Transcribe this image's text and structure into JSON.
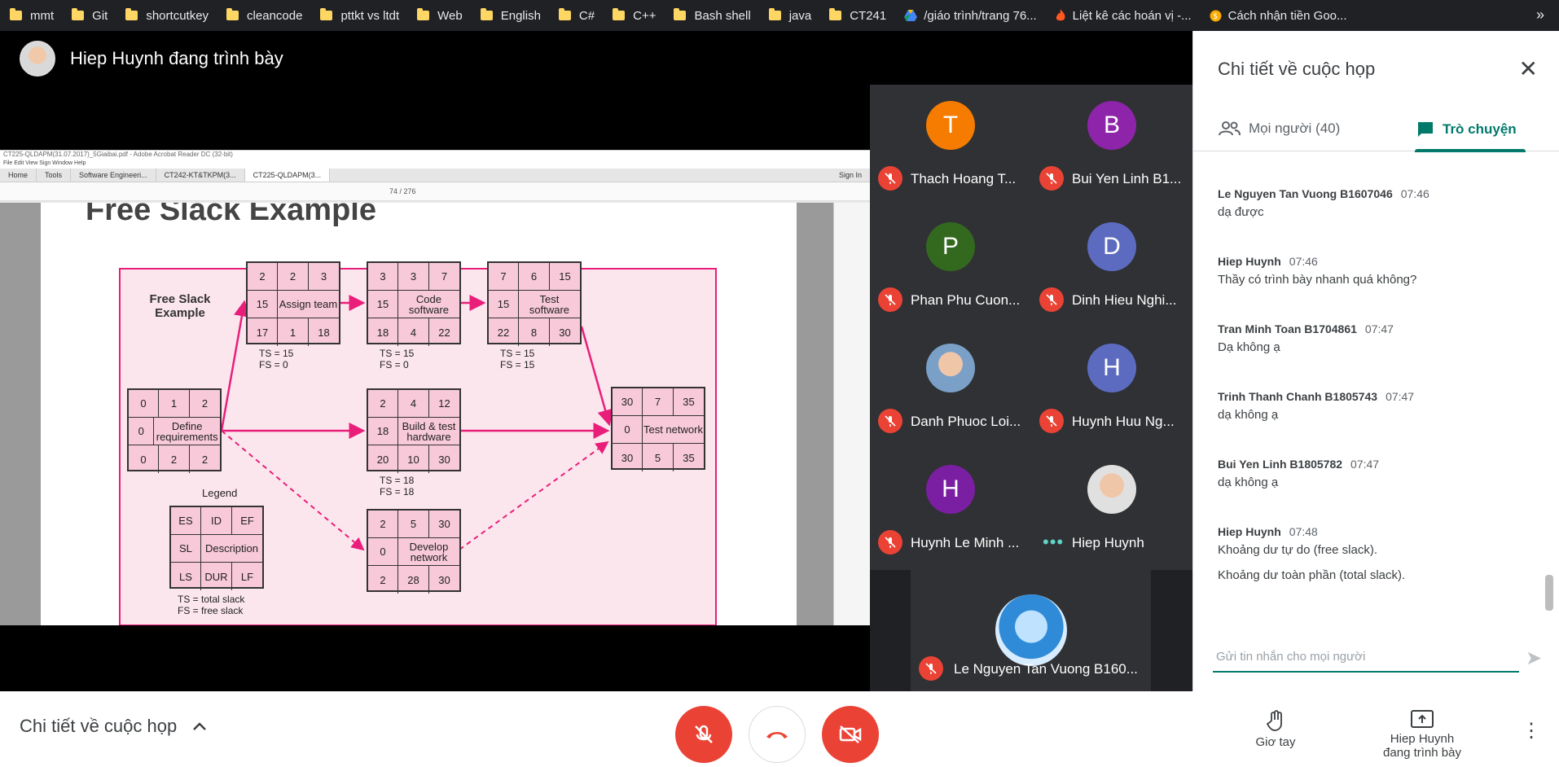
{
  "bookmarks": [
    "mmt",
    "Git",
    "shortcutkey",
    "cleancode",
    "pttkt vs ltdt",
    "Web",
    "English",
    "C#",
    "C++",
    "Bash shell",
    "java",
    "CT241",
    "/giáo trình/trang 76...",
    "Liệt kê các hoán vị -...",
    "Cách nhận tiền Goo..."
  ],
  "bookmarks_more": "»",
  "presenter": {
    "title": "Hiep Huynh đang trình bày"
  },
  "shared_screen": {
    "window_title": "CT225-QLDAPM(31.07.2017)_5Giaibai.pdf - Adobe Acrobat Reader DC (32-bit)",
    "menu": "File   Edit   View   Sign   Window   Help",
    "tabs": [
      "Home",
      "Tools",
      "Software Engineeri...",
      "CT242-KT&TKPM(3...",
      "CT225-QLDAPM(3..."
    ],
    "sign_in": "Sign In",
    "page_indicator": "74 / 276",
    "slide": {
      "title": "Free Slack Example",
      "box_label": "Free Slack Example",
      "nodes": [
        {
          "id": "define",
          "r1": [
            "0",
            "1",
            "2"
          ],
          "r2": [
            "0",
            "Define requirements"
          ],
          "r3": [
            "0",
            "2",
            "2"
          ]
        },
        {
          "id": "assign",
          "r1": [
            "2",
            "2",
            "3"
          ],
          "r2": [
            "15",
            "Assign team"
          ],
          "r3": [
            "17",
            "1",
            "18"
          ]
        },
        {
          "id": "code",
          "r1": [
            "3",
            "3",
            "7"
          ],
          "r2": [
            "15",
            "Code software"
          ],
          "r3": [
            "18",
            "4",
            "22"
          ]
        },
        {
          "id": "test",
          "r1": [
            "7",
            "6",
            "15"
          ],
          "r2": [
            "15",
            "Test software"
          ],
          "r3": [
            "22",
            "8",
            "30"
          ]
        },
        {
          "id": "build",
          "r1": [
            "2",
            "4",
            "12"
          ],
          "r2": [
            "18",
            "Build & test hardware"
          ],
          "r3": [
            "20",
            "10",
            "30"
          ]
        },
        {
          "id": "develop",
          "r1": [
            "2",
            "5",
            "30"
          ],
          "r2": [
            "0",
            "Develop network"
          ],
          "r3": [
            "2",
            "28",
            "30"
          ]
        },
        {
          "id": "testnet",
          "r1": [
            "30",
            "7",
            "35"
          ],
          "r2": [
            "0",
            "Test network"
          ],
          "r3": [
            "30",
            "5",
            "35"
          ]
        },
        {
          "id": "legend",
          "r1": [
            "ES",
            "ID",
            "EF"
          ],
          "r2": [
            "SL",
            "Description"
          ],
          "r3": [
            "LS",
            "DUR",
            "LF"
          ]
        }
      ],
      "ts_assign": [
        "TS = 15",
        "FS = 0"
      ],
      "ts_code": [
        "TS = 15",
        "FS = 0"
      ],
      "ts_test": [
        "TS = 15",
        "FS = 15"
      ],
      "ts_build": [
        "TS = 18",
        "FS = 18"
      ],
      "legend_title": "Legend",
      "legend_notes": [
        "TS = total slack",
        "FS = free slack"
      ]
    }
  },
  "participants": [
    {
      "name": "Thach Hoang T...",
      "initial": "T",
      "color": "#f57c00"
    },
    {
      "name": "Bui Yen Linh B1...",
      "initial": "B",
      "color": "#8e24aa"
    },
    {
      "name": "Phan Phu Cuon...",
      "initial": "P",
      "color": "#33691e"
    },
    {
      "name": "Dinh Hieu Nghi...",
      "initial": "D",
      "color": "#5c6bc0"
    },
    {
      "name": "Danh Phuoc Loi...",
      "initial": "",
      "color": "photo"
    },
    {
      "name": "Huynh Huu Ng...",
      "initial": "H",
      "color": "#5c6bc0"
    },
    {
      "name": "Huynh Le Minh ...",
      "initial": "H",
      "color": "#7b1fa2"
    },
    {
      "name": "Hiep Huynh",
      "initial": "",
      "color": "photo"
    }
  ],
  "self_tile": {
    "name": "Le Nguyen Tan Vuong B160..."
  },
  "panel": {
    "title": "Chi tiết về cuộc họp",
    "people_tab": "Mọi người (40)",
    "chat_tab": "Trò chuyện",
    "messages": [
      {
        "sender": "Le Nguyen Tan Vuong B1607046",
        "time": "07:46",
        "text": "dạ được"
      },
      {
        "sender": "Hiep Huynh",
        "time": "07:46",
        "text": "Thầy có trình bày nhanh quá không?"
      },
      {
        "sender": "Tran Minh Toan B1704861",
        "time": "07:47",
        "text": "Dạ không ạ"
      },
      {
        "sender": "Trinh Thanh Chanh B1805743",
        "time": "07:47",
        "text": "dạ không ạ"
      },
      {
        "sender": "Bui Yen Linh B1805782",
        "time": "07:47",
        "text": "dạ không ạ"
      },
      {
        "sender": "Hiep Huynh",
        "time": "07:48",
        "text": "Khoảng dư tự do (free slack).",
        "text2": "Khoảng dư toàn phần (total slack)."
      }
    ],
    "input_placeholder": "Gửi tin nhắn cho mọi người"
  },
  "bottom": {
    "details_label": "Chi tiết về cuộc họp",
    "raise_hand": "Giơ tay",
    "presenting": [
      "Hiep Huynh",
      "đang trình bày"
    ]
  },
  "colors": {
    "accent": "#00796b",
    "mute_red": "#ea4335",
    "slide_pink": "#e91e7a"
  }
}
